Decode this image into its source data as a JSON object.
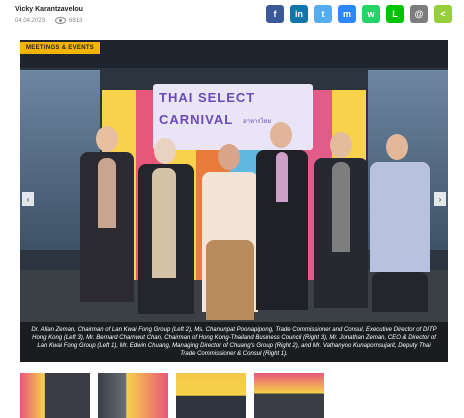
{
  "article": {
    "author": "Vicky Karantzavelou",
    "date": "04.04.2023",
    "views": "6813"
  },
  "share_buttons": [
    {
      "name": "facebook",
      "glyph": "f",
      "color": "#3b5998"
    },
    {
      "name": "linkedin",
      "glyph": "in",
      "color": "#0e76a8"
    },
    {
      "name": "twitter",
      "glyph": "t",
      "color": "#55acee"
    },
    {
      "name": "messenger",
      "glyph": "m",
      "color": "#2d88ff"
    },
    {
      "name": "whatsapp",
      "glyph": "w",
      "color": "#25d366"
    },
    {
      "name": "line",
      "glyph": "L",
      "color": "#00c300"
    },
    {
      "name": "email",
      "glyph": "@",
      "color": "#7d7d7d"
    },
    {
      "name": "share",
      "glyph": "<",
      "color": "#95d03a"
    }
  ],
  "hero": {
    "category": "MEETINGS & EVENTS",
    "banner_line1": "THAI SELECT",
    "banner_line2": "CARNIVAL",
    "banner_sub": "อาหารไทย",
    "caption": "Dr. Allan Zeman, Chairman of Lan Kwai Fong Group (Left 2), Ms. Chanunpat Poonapipong, Trade Commissioner and Consul, Executive Director of DITP Hong Kong (Left 3), Mr. Bernard Charnwut Chan, Chairman of Hong Kong-Thailand Business Council (Right 3), Mr. Jonathan Zeman, CEO & Director of Lan Kwai Fong Group (Left 1), Mr. Edwin Chuang, Managing Director of Chuang's Group (Right 2), and Mr. Vathanyoo Kunapornsujarit, Deputy Thai Trade Commissioner & Consul (Right 1).",
    "prev_glyph": "‹",
    "next_glyph": "›"
  },
  "colors": {
    "badge": "#f4b400"
  }
}
